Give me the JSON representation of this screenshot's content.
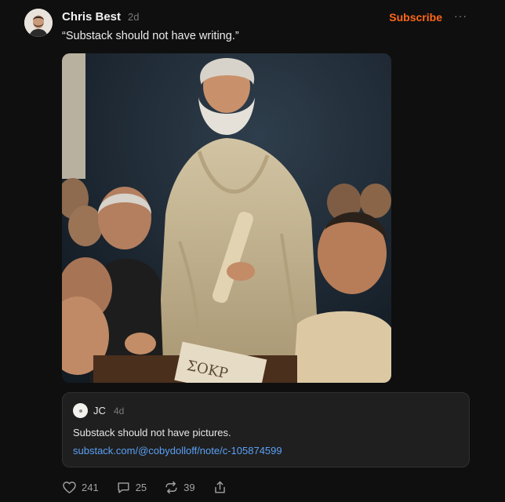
{
  "post": {
    "author": "Chris Best",
    "time": "2d",
    "subscribe_label": "Subscribe",
    "more_label": "···",
    "text": "“Substack should not have writing.”",
    "image_sign_text": "ΣΟΚΡ"
  },
  "quoted_note": {
    "author": "JC",
    "time": "4d",
    "text": "Substack should not have pictures.",
    "link": "substack.com/@cobydolloff/note/c-105874599"
  },
  "actions": {
    "likes": "241",
    "comments": "25",
    "restacks": "39"
  },
  "icons": [
    "heart-icon",
    "comment-icon",
    "restack-icon",
    "share-icon"
  ],
  "colors": {
    "accent": "#ff6719",
    "link": "#5aa0f5",
    "background": "#0f0f0f"
  }
}
